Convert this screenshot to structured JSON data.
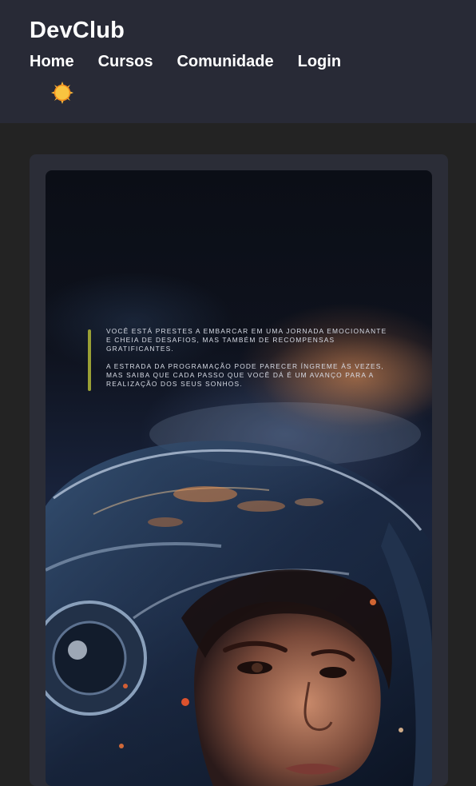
{
  "header": {
    "brand": "DevClub",
    "nav": [
      {
        "label": "Home"
      },
      {
        "label": "Cursos"
      },
      {
        "label": "Comunidade"
      },
      {
        "label": "Login"
      }
    ],
    "theme_toggle_icon": "sun-icon"
  },
  "poster": {
    "paragraphs": [
      "Você está prestes a embarcar em uma jornada emocionante e cheia de desafios, mas também de recompensas gratificantes.",
      "A estrada da programação pode parecer íngreme às vezes, mas saiba que cada passo que você dá é um avanço para a realização dos seus sonhos."
    ],
    "image": "astronaut-woman-helmet-illustration",
    "accent_color": "#9aa035"
  },
  "colors": {
    "page_bg": "#232323",
    "header_bg": "#282a36",
    "card_bg": "#2b2d37",
    "sun": "#f6b73c"
  }
}
